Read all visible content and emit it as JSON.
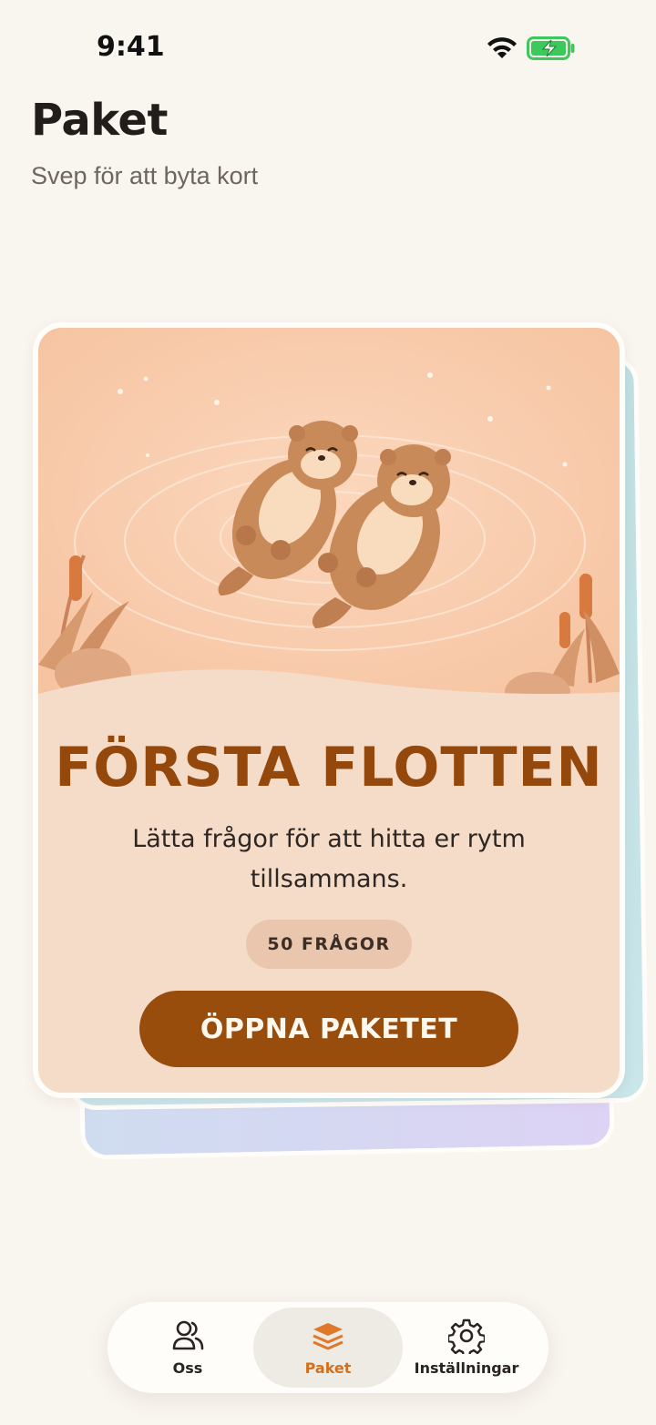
{
  "status_bar": {
    "time": "9:41"
  },
  "header": {
    "title": "Paket",
    "subtitle": "Svep för att byta kort"
  },
  "deck": {
    "title": "FÖRSTA FLOTTEN",
    "description": "Lätta frågor för att hitta er rytm tillsammans.",
    "question_count": "50 FRÅGOR",
    "open_button": "ÖPPNA PAKETET",
    "colors": {
      "accent": "#984d0c",
      "card_bg": "#f5dcc9",
      "badge_bg": "#e9c6ad"
    }
  },
  "nav": {
    "items": [
      {
        "label": "Oss",
        "icon": "users-icon",
        "active": false
      },
      {
        "label": "Paket",
        "icon": "layers-icon",
        "active": true
      },
      {
        "label": "Inställningar",
        "icon": "gear-icon",
        "active": false
      }
    ],
    "active_color": "#d4701c"
  }
}
